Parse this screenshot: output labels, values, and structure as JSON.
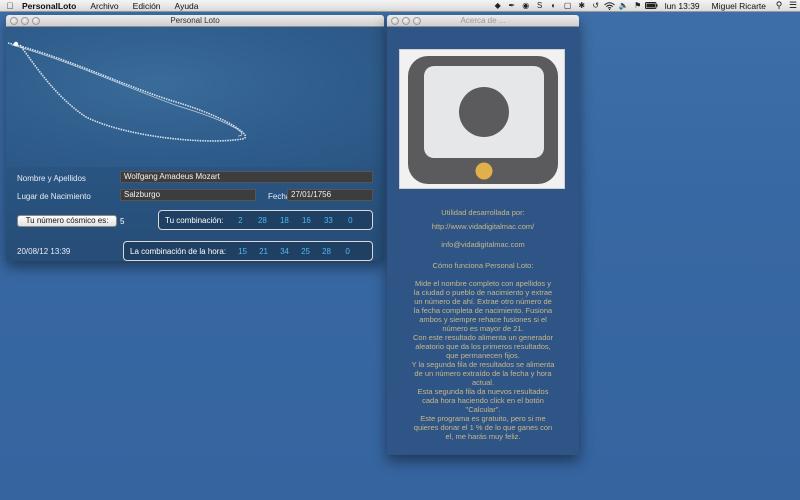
{
  "menubar": {
    "app_name": "PersonalLoto",
    "menus": [
      "Archivo",
      "Edición",
      "Ayuda"
    ],
    "clock": "lun 13:39",
    "user": "Miguel Ricarte"
  },
  "main_window": {
    "title": "Personal Loto",
    "name_label": "Nombre y Apellidos",
    "name_value": "Wolfgang Amadeus Mozart",
    "place_label": "Lugar de Nacimiento",
    "place_value": "Salzburgo",
    "date_label": "Fecha",
    "date_value": "27/01/1756",
    "cosmic_button": "Tu número cósmico es:",
    "cosmic_value": "5",
    "combo_label": "Tu combinación:",
    "combo_numbers": [
      "2",
      "28",
      "18",
      "16",
      "33",
      "0"
    ],
    "timestamp": "20/08/12 13:39",
    "hour_combo_label": "La combinación de la hora:",
    "hour_combo_numbers": [
      "15",
      "21",
      "34",
      "25",
      "28",
      "0"
    ]
  },
  "about_window": {
    "title": "Acerca de ...",
    "developed_by": "Utilidad desarrollada por:",
    "website": "http://www.vidadigitalmac.com/",
    "email": "info@vidadigitalmac.com",
    "how_title": "Cómo funciona Personal Loto:",
    "description": [
      "Mide el nombre completo con apellidos y",
      "la ciudad o pueblo de nacimiento y extrae",
      "un número de ahí. Extrae otro número de",
      "la fecha completa de nacimiento. Fusiona",
      "ambos y siempre rehace fusiones si el",
      "número es mayor de 21.",
      "Con este resultado alimenta un generador",
      "aleatorio que da los primeros resultados,",
      "que permanecen fijos.",
      "Y la segunda fila de resultados se alimenta",
      "de un número extraído de la fecha y hora",
      "actual.",
      "Esta segunda fila da nuevos resultados",
      "cada hora haciendo click en el botón",
      "\"Calcular\".",
      "Este programa es gratuito, pero si me",
      "quieres donar el 1 % de lo que ganes con",
      "el, me harás muy feliz."
    ]
  },
  "colors": {
    "desktop": "#3868a3",
    "result_numbers": "#4fb7f0",
    "about_text": "#c9b78a",
    "icon_dot": "#e2b04a"
  }
}
